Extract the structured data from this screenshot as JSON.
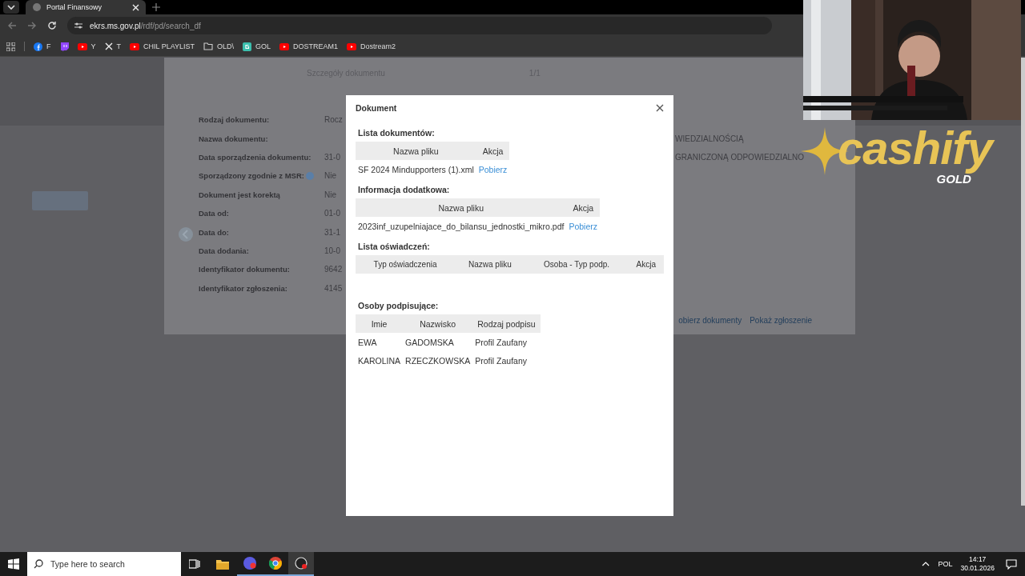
{
  "browser": {
    "tab_title": "Portal Finansowy",
    "url_host": "ekrs.ms.gov.pl",
    "url_path": "/rdf/pd/search_df",
    "bookmarks": [
      {
        "label": "F",
        "kind": "facebook"
      },
      {
        "kind": "twitch"
      },
      {
        "label": "Y",
        "kind": "youtube"
      },
      {
        "label": "T",
        "kind": "x"
      },
      {
        "label": "CHIL PLAYLIST",
        "kind": "youtube"
      },
      {
        "label": "OLD\\",
        "kind": "folder"
      },
      {
        "label": "GOL",
        "kind": "g"
      },
      {
        "label": "DOSTREAM1",
        "kind": "youtube"
      },
      {
        "label": "Dostream2",
        "kind": "youtube"
      }
    ]
  },
  "details_panel": {
    "title": "Szczegóły dokumentu",
    "pager": "1/1",
    "fields": [
      {
        "label": "Rodzaj dokumentu:",
        "value": "Rocz",
        "info": false
      },
      {
        "label": "Nazwa dokumentu:",
        "info": false
      },
      {
        "label": "Data sporządzenia dokumentu:",
        "value": "31-0",
        "info": false
      },
      {
        "label": "Sporządzony zgodnie z MSR:",
        "value": "Nie",
        "info": true
      },
      {
        "label": "Dokument jest korektą",
        "value": "Nie",
        "info": false
      },
      {
        "label": "Data od:",
        "value": "01-0",
        "info": false
      },
      {
        "label": "Data do:",
        "value": "31-1",
        "info": false
      },
      {
        "label": "Data dodania:",
        "value": "10-0",
        "info": false
      },
      {
        "label": "Identyfikator dokumentu:",
        "value": "9642",
        "info": false
      },
      {
        "label": "Identyfikator zgłoszenia:",
        "value": "4145",
        "info": false
      }
    ],
    "right_values": [
      "WIEDZIALNOŚCIĄ",
      "GRANICZONĄ ODPOWIEDZIALNO"
    ],
    "links": [
      "obierz dokumenty",
      "Pokaż zgłoszenie"
    ]
  },
  "dialog": {
    "title": "Dokument",
    "sections": [
      {
        "heading": "Lista dokumentów:",
        "columns": [
          "Nazwa pliku",
          "Akcja"
        ],
        "rows": [
          [
            {
              "text": "SF 2024 Mindupporters (1).xml",
              "kind": "text"
            },
            {
              "text": "Pobierz",
              "kind": "link"
            }
          ]
        ]
      },
      {
        "heading": "Informacja dodatkowa:",
        "columns": [
          "Nazwa pliku",
          "Akcja"
        ],
        "rows": [
          [
            {
              "text": "2023inf_uzupelniajace_do_bilansu_jednostki_mikro.pdf",
              "kind": "text"
            },
            {
              "text": "Pobierz",
              "kind": "link"
            }
          ]
        ]
      },
      {
        "heading": "Lista oświadczeń:",
        "columns": [
          "Typ oświadczenia",
          "Nazwa pliku",
          "Osoba - Typ podp.",
          "Akcja"
        ]
      },
      {
        "heading": "Osoby podpisujące:",
        "columns": [
          "Imie",
          "Nazwisko",
          "Rodzaj podpisu"
        ],
        "rows": [
          [
            {
              "text": "EWA",
              "kind": "text"
            },
            {
              "text": "GADOMSKA",
              "kind": "text"
            },
            {
              "text": "Profil Zaufany",
              "kind": "text"
            }
          ],
          [
            {
              "text": "KAROLINA",
              "kind": "text"
            },
            {
              "text": "RZECZKOWSKA",
              "kind": "text"
            },
            {
              "text": "Profil Zaufany",
              "kind": "text"
            }
          ]
        ]
      }
    ]
  },
  "overlay": {
    "logo": "cashify",
    "logo_sub": "GOLD"
  },
  "taskbar": {
    "search_placeholder": "Type here to search",
    "language": "POL",
    "time": "14:17",
    "date": "30.01.2026"
  }
}
